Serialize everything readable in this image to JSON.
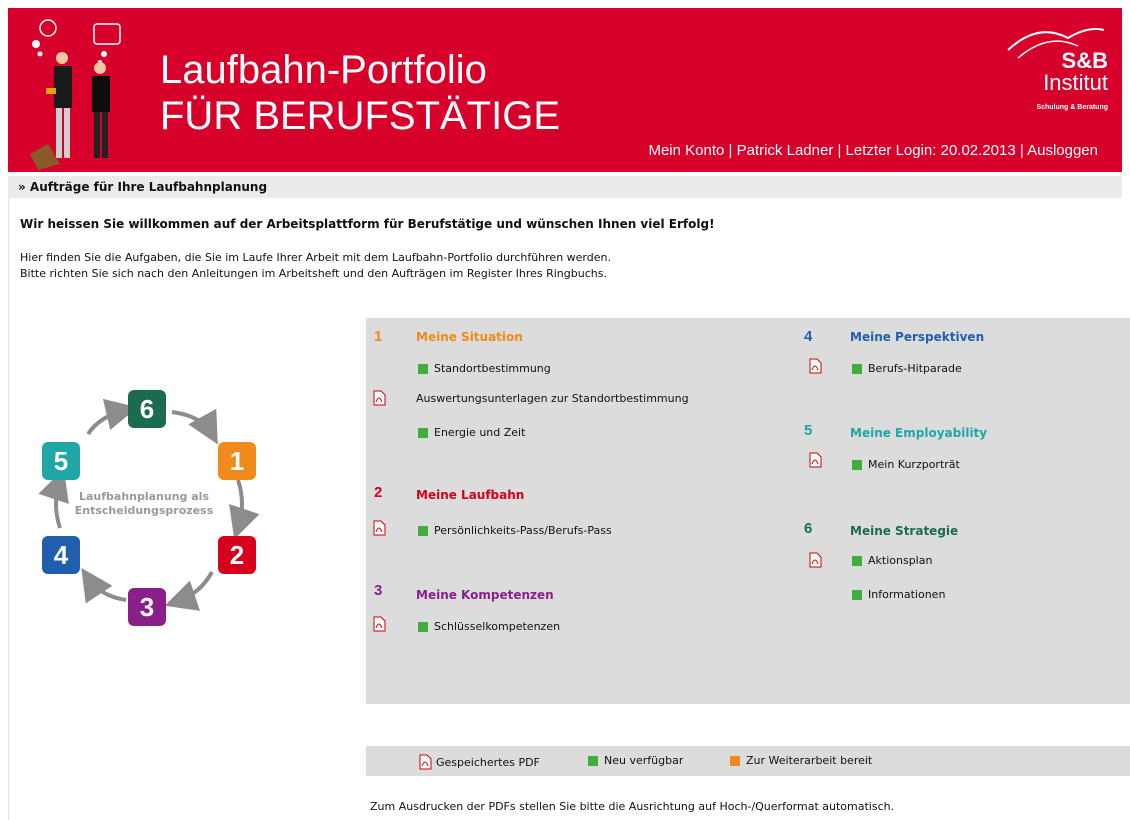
{
  "header": {
    "title_line1": "Laufbahn-Portfolio",
    "title_line2": "FÜR BERUFSTÄTIGE",
    "logo": {
      "brand": "S&B",
      "name": "Institut",
      "tagline": "Schulung & Beratung"
    },
    "user_bar": {
      "account": "Mein Konto",
      "sep1": " | ",
      "user": "Patrick Ladner",
      "sep2": " | ",
      "last_login": "Letzter Login: 20.02.2013",
      "sep3": " | ",
      "logout": "Ausloggen"
    }
  },
  "breadcrumb": "» Aufträge für Ihre Laufbahnplanung",
  "welcome": "Wir heissen Sie willkommen auf der Arbeitsplattform für Berufstätige und wünschen Ihnen viel Erfolg!",
  "intro": {
    "line1": "Hier finden Sie die Aufgaben, die Sie im Laufe Ihrer Arbeit mit dem Laufbahn-Portfolio durchführen werden.",
    "line2": "Bitte richten Sie sich nach den Anleitungen im Arbeitsheft und den Aufträgen im Register Ihres Ringbuchs."
  },
  "cycle": {
    "label_line1": "Laufbahnplanung als",
    "label_line2": "Entscheidungsprozess",
    "steps": [
      "1",
      "2",
      "3",
      "4",
      "5",
      "6"
    ],
    "colors": [
      "#f08a1a",
      "#d6001c",
      "#8a1f8a",
      "#1f5fae",
      "#1fa6a6",
      "#1a6b4f"
    ]
  },
  "sections": {
    "s1": {
      "num": "1",
      "title": "Meine Situation",
      "color": "#f08a1a",
      "items": [
        "Standortbestimmung",
        "Auswertungsunterlagen zur Standortbestimmung",
        "Energie und Zeit"
      ]
    },
    "s2": {
      "num": "2",
      "title": "Meine Laufbahn",
      "color": "#d6001c",
      "items": [
        "Persönlichkeits-Pass/Berufs-Pass"
      ]
    },
    "s3": {
      "num": "3",
      "title": "Meine Kompetenzen",
      "color": "#8a1f8a",
      "items": [
        "Schlüsselkompetenzen"
      ]
    },
    "s4": {
      "num": "4",
      "title": "Meine Perspektiven",
      "color": "#1f5fae",
      "items": [
        "Berufs-Hitparade"
      ]
    },
    "s5": {
      "num": "5",
      "title": "Meine Employability",
      "color": "#1fa6a6",
      "items": [
        "Mein Kurzporträt"
      ]
    },
    "s6": {
      "num": "6",
      "title": "Meine Strategie",
      "color": "#1a6b4f",
      "items": [
        "Aktionsplan",
        "Informationen"
      ]
    }
  },
  "legend": {
    "pdf": "Gespeichertes PDF",
    "new": "Neu verfügbar",
    "continue": "Zur Weiterarbeit bereit"
  },
  "footer_note": "Zum Ausdrucken der PDFs stellen Sie bitte die Ausrichtung auf Hoch-/Querformat automatisch."
}
